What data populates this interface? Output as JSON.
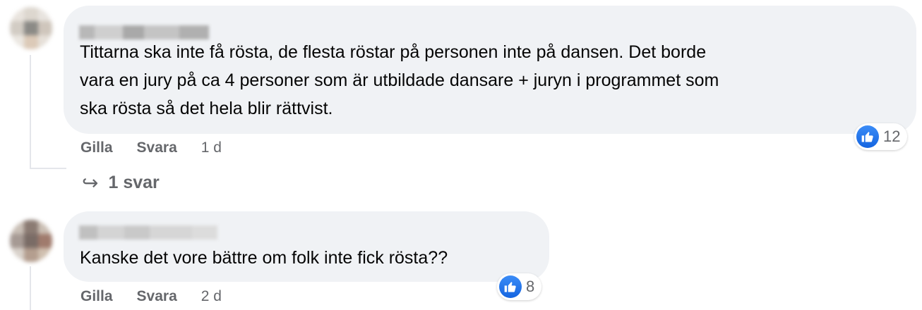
{
  "comments": [
    {
      "author_name_hidden": true,
      "text_lines": [
        "Tittarna ska inte få rösta, de flesta röstar på personen inte på dansen. Det borde",
        "vara en jury på ca 4 personer som är utbildade dansare + juryn i programmet som",
        "ska rösta så det hela blir rättvist."
      ],
      "actions": {
        "like": "Gilla",
        "reply": "Svara",
        "time": "1 d"
      },
      "reactions": {
        "icon": "like-icon",
        "count": "12"
      },
      "replies_label": "1 svar",
      "replies_icon": "reply-arrow-icon"
    },
    {
      "author_name_hidden": true,
      "text_lines": [
        "Kanske det vore bättre om folk inte fick rösta??"
      ],
      "actions": {
        "like": "Gilla",
        "reply": "Svara",
        "time": "2 d"
      },
      "reactions": {
        "icon": "like-icon",
        "count": "8"
      }
    }
  ],
  "colors": {
    "bubble": "#f0f2f5",
    "secondary_text": "#65676b",
    "like_blue": "#1877f2",
    "thread_line": "#e4e6eb"
  }
}
